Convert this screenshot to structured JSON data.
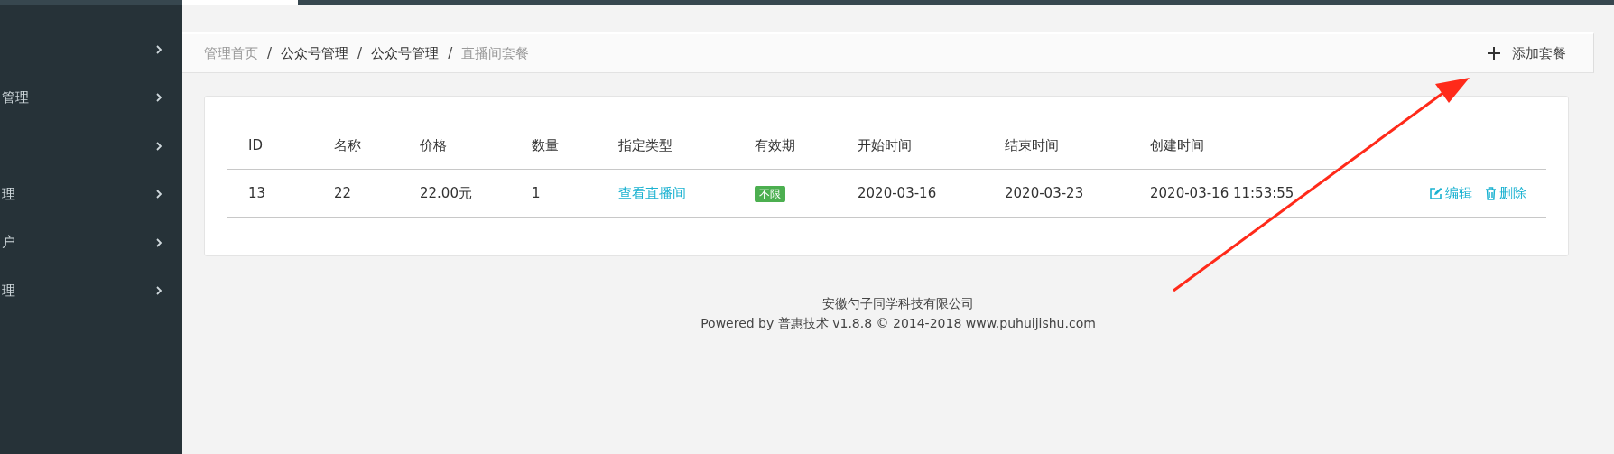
{
  "sidebar": {
    "items": [
      {
        "kind": "menu"
      },
      {
        "kind": "menu",
        "label": "管理"
      },
      {
        "kind": "menu"
      },
      {
        "kind": "menu",
        "label": "理"
      },
      {
        "kind": "menu",
        "label": "户"
      },
      {
        "kind": "menu",
        "label": "理"
      }
    ]
  },
  "breadcrumb": {
    "items": [
      {
        "label": "管理首页",
        "kind": "muted"
      },
      {
        "label": "公众号管理",
        "kind": "link"
      },
      {
        "label": "公众号管理",
        "kind": "link"
      },
      {
        "label": "直播间套餐",
        "kind": "muted"
      }
    ],
    "separator": "/"
  },
  "add_button": {
    "label": "添加套餐"
  },
  "table": {
    "columns": [
      "ID",
      "名称",
      "价格",
      "数量",
      "指定类型",
      "有效期",
      "开始时间",
      "结束时间",
      "创建时间"
    ],
    "rows": [
      {
        "id": "13",
        "name": "22",
        "price": "22.00元",
        "quantity": "1",
        "type_link": "查看直播间",
        "validity": "不限",
        "start": "2020-03-16",
        "end": "2020-03-23",
        "created": "2020-03-16 11:53:55",
        "actions": [
          {
            "kind": "edit",
            "label": "编辑"
          },
          {
            "kind": "delete",
            "label": "删除"
          }
        ]
      }
    ]
  },
  "footer": {
    "company": "安徽勺子同学科技有限公司",
    "powered": "Powered by 普惠技术 v1.8.8 © 2014-2018 www.puhuijishu.com"
  },
  "annotation": {
    "kind": "arrow"
  }
}
